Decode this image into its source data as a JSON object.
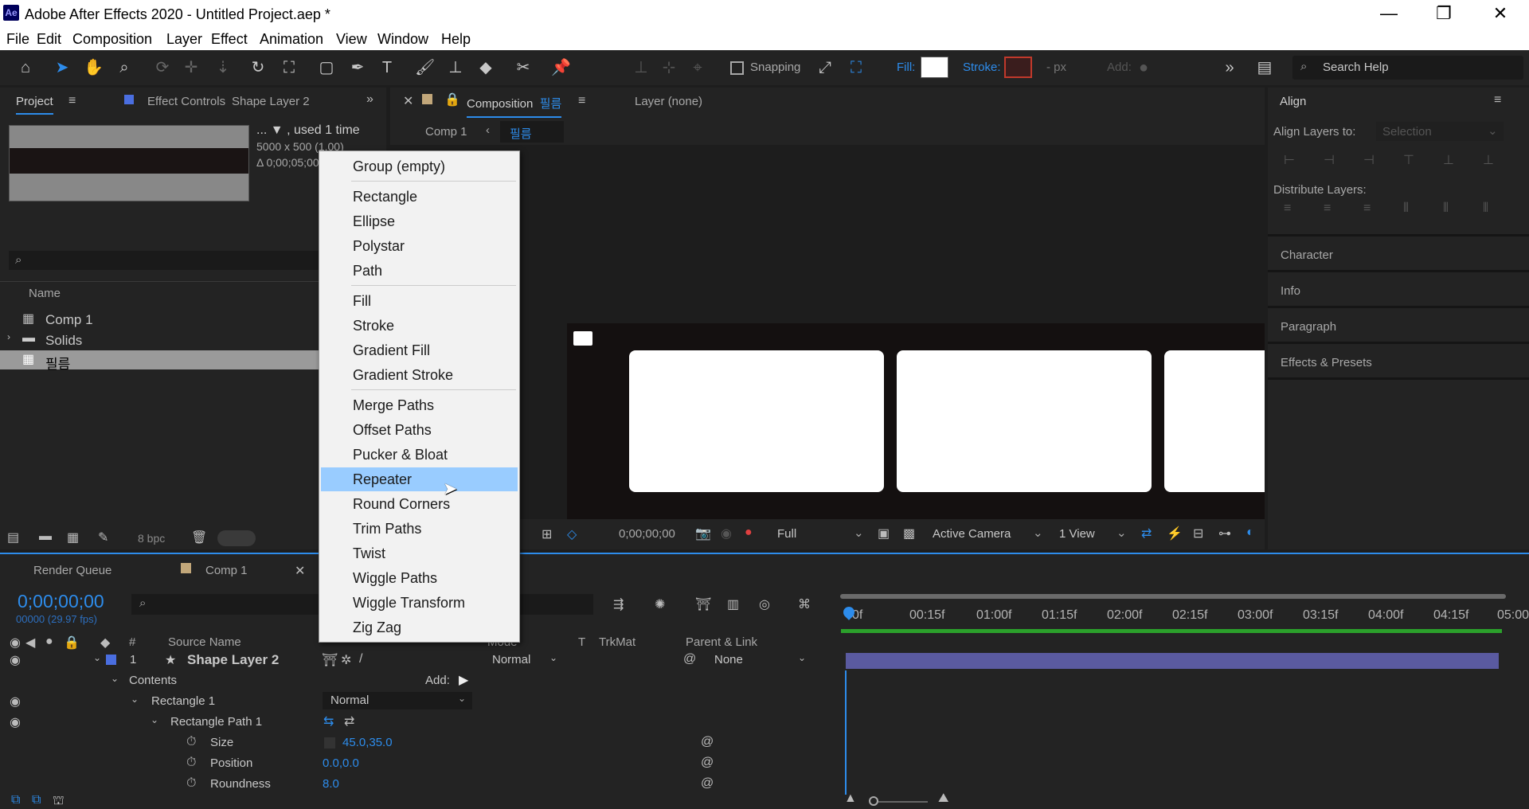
{
  "window": {
    "title": "Adobe After Effects 2020 - Untitled Project.aep *",
    "logo": "Ae",
    "minimize": "—",
    "restore": "❐",
    "close": "✕"
  },
  "menu": [
    "File",
    "Edit",
    "Composition",
    "Layer",
    "Effect",
    "Animation",
    "View",
    "Window",
    "Help"
  ],
  "toolbar": {
    "snapping": "Snapping",
    "fill_label": "Fill:",
    "stroke_label": "Stroke:",
    "px_label": "- px",
    "add_label": "Add:",
    "search_placeholder": "Search Help",
    "fill_color": "#ffffff",
    "stroke_color": "#c0392b"
  },
  "project": {
    "tab": "Project",
    "effect_controls_tab": "Effect Controls",
    "effect_controls_layer": "Shape Layer 2",
    "info_line1": "... ▼ , used 1 time",
    "info_line2": "5000 x 500 (1.00)",
    "info_line3": "Δ 0;00;05;00",
    "name_header": "Name",
    "items": [
      {
        "name": "Comp 1"
      },
      {
        "name": "Solids"
      },
      {
        "name": "필름"
      }
    ],
    "bpc": "8 bpc"
  },
  "composition": {
    "tab": "Composition",
    "tab_name": "필름",
    "layer_tab": "Layer (none)",
    "breadcrumb_comp1": "Comp 1",
    "breadcrumb_current": "필름",
    "timecode": "0;00;00;00",
    "resolution": "Full",
    "camera": "Active Camera",
    "views": "1 View"
  },
  "align": {
    "title": "Align",
    "align_layers_to": "Align Layers to:",
    "selection": "Selection",
    "distribute_layers": "Distribute Layers:",
    "panels": [
      "Character",
      "Info",
      "Paragraph",
      "Effects & Presets"
    ]
  },
  "context_menu": {
    "items": [
      "Group (empty)",
      "Rectangle",
      "Ellipse",
      "Polystar",
      "Path",
      "Fill",
      "Stroke",
      "Gradient Fill",
      "Gradient Stroke",
      "Merge Paths",
      "Offset Paths",
      "Pucker & Bloat",
      "Repeater",
      "Round Corners",
      "Trim Paths",
      "Twist",
      "Wiggle Paths",
      "Wiggle Transform",
      "Zig Zag"
    ],
    "highlighted": "Repeater"
  },
  "timeline": {
    "render_queue_tab": "Render Queue",
    "comp_tab": "Comp 1",
    "timecode": "0;00;00;00",
    "fps": "00000 (29.97 fps)",
    "headers": {
      "num": "#",
      "source_name": "Source Name",
      "mode": "Mode",
      "t": "T",
      "trkmat": "TrkMat",
      "parent": "Parent & Link"
    },
    "layer": {
      "num": "1",
      "name": "Shape Layer 2",
      "mode": "Normal",
      "parent": "None"
    },
    "contents": "Contents",
    "add": "Add:",
    "rect": "Rectangle 1",
    "rect_mode": "Normal",
    "rect_path": "Rectangle Path 1",
    "props": [
      {
        "name": "Size",
        "value": "45.0,35.0"
      },
      {
        "name": "Position",
        "value": "0.0,0.0"
      },
      {
        "name": "Roundness",
        "value": "8.0"
      }
    ],
    "ruler": [
      "0f",
      "00:15f",
      "01:00f",
      "01:15f",
      "02:00f",
      "02:15f",
      "03:00f",
      "03:15f",
      "04:00f",
      "04:15f",
      "05:00"
    ]
  }
}
